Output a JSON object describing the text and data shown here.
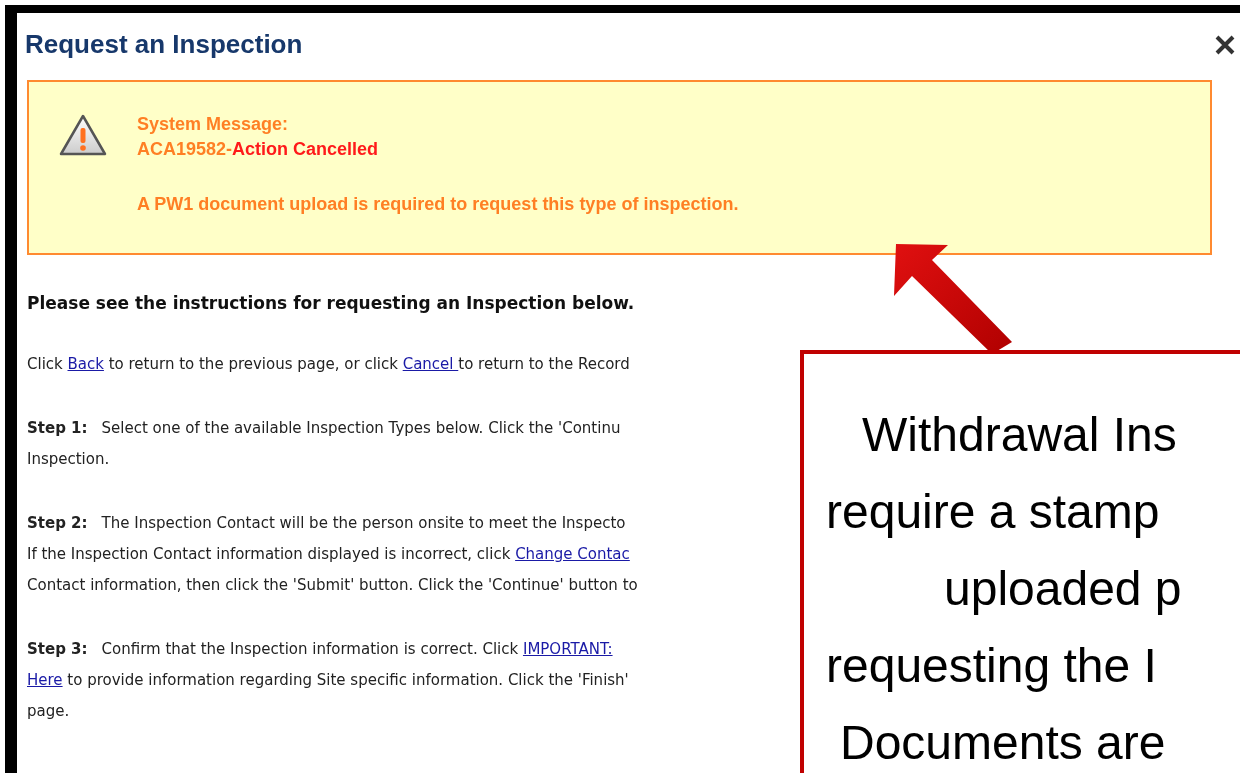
{
  "dialog": {
    "title": "Request an Inspection"
  },
  "system_message": {
    "heading": "System Message:",
    "code": "ACA19582-",
    "status": "Action Cancelled",
    "detail": "A PW1 document upload is required to request this type of inspection."
  },
  "instructions_heading": "Please see the instructions for requesting an Inspection below.",
  "intro": [
    [
      {
        "text": "Click "
      },
      {
        "text": "Back",
        "link": true
      },
      {
        "text": " to return to the previous page, or click "
      },
      {
        "text": "Cancel ",
        "link": true
      },
      {
        "text": "to return to the Record"
      }
    ]
  ],
  "steps": [
    {
      "label": "Step 1:",
      "lines": [
        [
          {
            "text": "Select one of the available Inspection Types below. Click the 'Continu"
          }
        ],
        [
          {
            "text": "Inspection."
          }
        ]
      ]
    },
    {
      "label": "Step 2:",
      "lines": [
        [
          {
            "text": "The Inspection Contact will be the person onsite to meet the Inspecto"
          }
        ],
        [
          {
            "text": "If the Inspection Contact information displayed is incorrect, click "
          },
          {
            "text": "Change Contac",
            "link": true
          }
        ],
        [
          {
            "text": "Contact information, then click the 'Submit' button. Click the 'Continue' button to"
          }
        ]
      ]
    },
    {
      "label": "Step 3:",
      "lines": [
        [
          {
            "text": "Confirm that the Inspection information is correct. Click "
          },
          {
            "text": "IMPORTANT:",
            "link": true
          }
        ],
        [
          {
            "text": "Here",
            "link": true
          },
          {
            "text": " to provide information regarding Site specific information. Click the 'Finish'"
          }
        ],
        [
          {
            "text": "page."
          }
        ]
      ]
    }
  ],
  "callout": {
    "lines": [
      "Withdrawal Ins",
      "require a stamp",
      "uploaded p",
      "requesting the I",
      "Documents are"
    ]
  }
}
